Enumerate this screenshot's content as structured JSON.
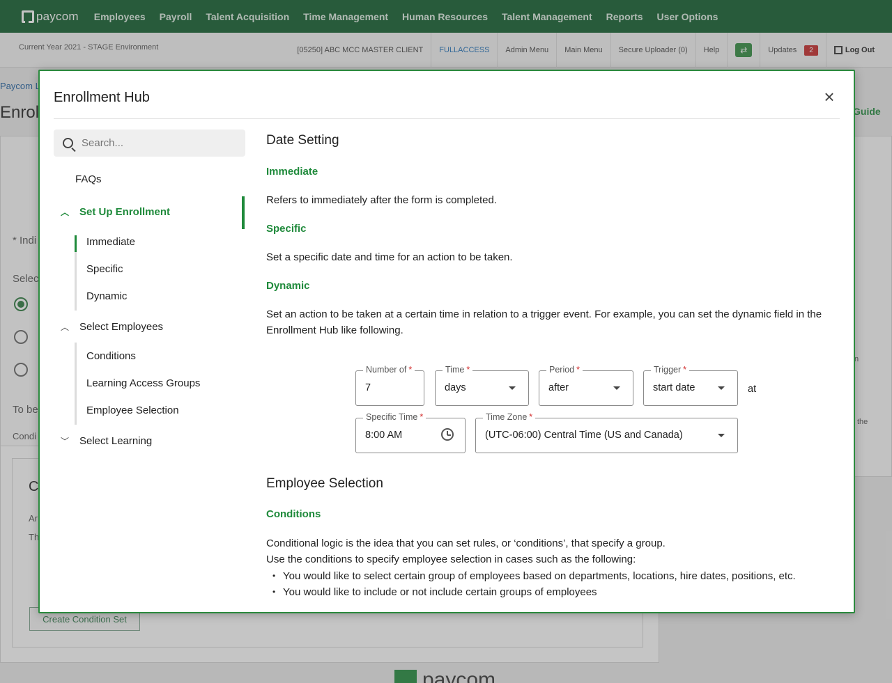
{
  "topnav": {
    "logo": "paycom",
    "items": [
      "Employees",
      "Payroll",
      "Talent Acquisition",
      "Time Management",
      "Human Resources",
      "Talent Management",
      "Reports",
      "User Options"
    ]
  },
  "subbar": {
    "environment": "Current Year 2021 - STAGE Environment",
    "client": "[05250] ABC MCC MASTER CLIENT",
    "access": "FULLACCESS",
    "admin_menu": "Admin Menu",
    "main_menu": "Main Menu",
    "secure_uploader": "Secure Uploader (0)",
    "help": "Help",
    "updates": "Updates",
    "updates_count": "2",
    "logout": "Log Out"
  },
  "background": {
    "breadcrumb": "Paycom L",
    "title": "Enroll",
    "guide": "Guide",
    "indicator": "* Indi",
    "select": "Selec",
    "to_be": "To be",
    "cond": "Condi",
    "card_letter": "C",
    "line1": "Ar",
    "line2": "Th",
    "right_n": "n",
    "right_the": "the",
    "create_button": "Create Condition Set",
    "footer_logo": "paycom"
  },
  "modal": {
    "title": "Enrollment Hub",
    "close_glyph": "×",
    "search_placeholder": "Search...",
    "nav": {
      "faqs": "FAQs",
      "setup": "Set Up Enrollment",
      "setup_items": [
        "Immediate",
        "Specific",
        "Dynamic"
      ],
      "select_employees": "Select Employees",
      "select_items": [
        "Conditions",
        "Learning Access Groups",
        "Employee Selection"
      ],
      "select_learning": "Select Learning",
      "chevron_up": "︿",
      "chevron_down": "﹀"
    },
    "content": {
      "date_setting": "Date Setting",
      "immediate_h": "Immediate",
      "immediate_p": "Refers to immediately after the form is completed.",
      "specific_h": "Specific",
      "specific_p": "Set a specific date and time for an action to be taken.",
      "dynamic_h": "Dynamic",
      "dynamic_p": "Set an action to be taken at a certain time in relation to a trigger event. For example, you can set the dynamic field in the Enrollment Hub like following.",
      "employee_selection": "Employee Selection",
      "conditions_h": "Conditions",
      "conditions_p1": "Conditional logic is the idea that you can set rules, or ‘conditions’, that specify a group.",
      "conditions_p2": "Use the conditions to specify employee selection in cases such as the following:",
      "bullets": [
        "You would like to select certain group of employees based on departments, locations, hire dates, positions, etc.",
        "You would like to include or not include certain groups of employees"
      ]
    },
    "form": {
      "number_label": "Number of",
      "number_value": "7",
      "time_label": "Time",
      "time_value": "days",
      "period_label": "Period",
      "period_value": "after",
      "trigger_label": "Trigger",
      "trigger_value": "start date",
      "at": "at",
      "specific_time_label": "Specific Time",
      "specific_time_value": "8:00 AM",
      "timezone_label": "Time Zone",
      "timezone_value": "(UTC-06:00) Central Time (US and Canada)",
      "required_mark": "*"
    }
  }
}
